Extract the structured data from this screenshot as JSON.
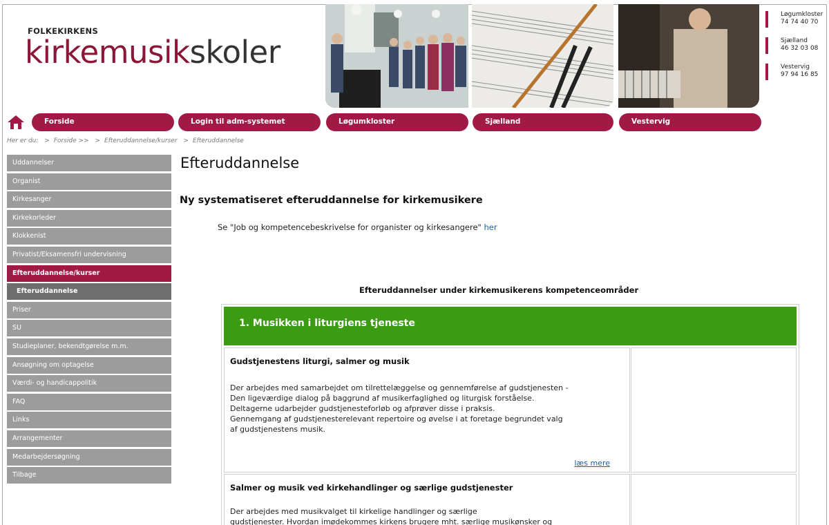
{
  "brand": {
    "org": "FOLKEKIRKENS",
    "name_part1": "kirkemusik",
    "name_part2": "skoler"
  },
  "contacts": [
    {
      "place": "Løgumkloster",
      "phone": "74 74 40 70"
    },
    {
      "place": "Sjælland",
      "phone": "46 32 03 08"
    },
    {
      "place": "Vestervig",
      "phone": "97 94 16 85"
    }
  ],
  "nav": {
    "items": [
      "Forside",
      "Login til adm-systemet",
      "Løgumkloster",
      "Sjælland",
      "Vestervig"
    ]
  },
  "breadcrumb": {
    "label": "Her er du:",
    "items": [
      "Forside >>",
      "Efteruddannelse/kurser",
      "Efteruddannelse"
    ]
  },
  "sidebar": {
    "items": [
      "Uddannelser",
      "Organist",
      "Kirkesanger",
      "Kirkekorleder",
      "Klokkenist",
      "Privatist/Eksamensfri undervisning",
      "Efteruddannelse/kurser",
      "Efteruddannelse",
      "Priser",
      "SU",
      "Studieplaner, bekendtgørelse m.m.",
      "Ansøgning om optagelse",
      "Værdi- og handicappolitik",
      "FAQ",
      "Links",
      "Arrangementer",
      "Medarbejdersøgning",
      "Tilbage"
    ]
  },
  "main": {
    "title": "Efteruddannelse",
    "subtitle": "Ny systematiseret efteruddannelse for kirkemusikere",
    "intro_text": "Se \"Job og kompetencebeskrivelse for organister og kirkesangere\"",
    "intro_link": "her",
    "table_caption": "Efteruddannelser under kirkemusikerens kompetenceområder",
    "section_title": "1. Musikken i liturgiens tjeneste",
    "entries": [
      {
        "title": "Gudstjenestens liturgi, salmer og musik",
        "lines": [
          "Der arbejdes med samarbejdet om tilrettelæggelse og gennemførelse af gudstjenesten -",
          "Den ligeværdige dialog på baggrund af musikerfaglighed og liturgisk forståelse.",
          "Deltagerne udarbejder gudstjenesteforløb og afprøver disse i praksis.",
          "Gennemgang af gudstjenesterelevant repertoire og øvelse i at foretage begrundet valg",
          "af gudstjenestens musik."
        ],
        "read_more": "læs mere"
      },
      {
        "title": "Salmer og musik ved kirkehandlinger og særlige gudstjenester",
        "lines": [
          "Der arbejdes med musikvalget til kirkelige handlinger og særlige",
          "gudstjenester. Hvordan imødekommes kirkens brugere mht. særlige musikønsker og"
        ]
      }
    ]
  },
  "colors": {
    "brand": "#a11a45",
    "sidebar": "#9c9c9c",
    "section_green": "#3b9c13",
    "link": "#1a5fa8"
  }
}
